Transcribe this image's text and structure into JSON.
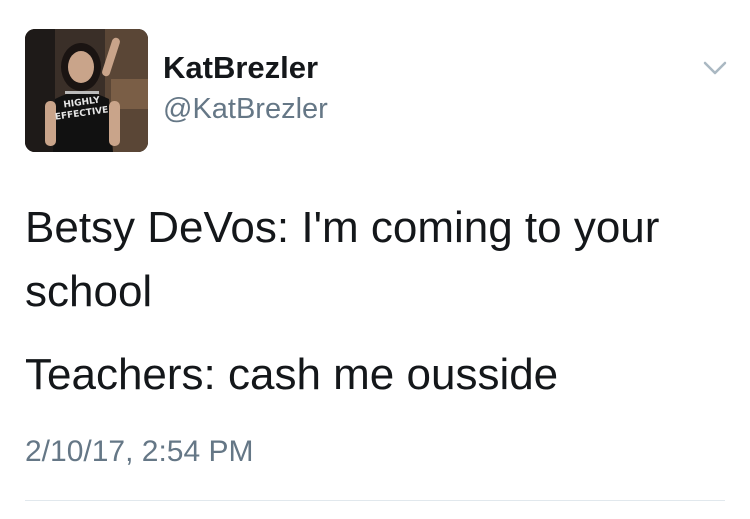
{
  "user": {
    "display_name": "KatBrezler",
    "handle": "@KatBrezler",
    "avatar_shirt_text": "HIGHLY EFFECTIVE",
    "avatar_icon": "profile-photo"
  },
  "menu": {
    "icon": "chevron-down-icon"
  },
  "tweet": {
    "line1": "Betsy DeVos: I'm coming to your school",
    "line2": "Teachers: cash me ousside",
    "timestamp": "2/10/17, 2:54 PM"
  },
  "colors": {
    "text": "#14171a",
    "secondary": "#657786",
    "divider": "#e1e8ed",
    "caret": "#aab8c2"
  }
}
